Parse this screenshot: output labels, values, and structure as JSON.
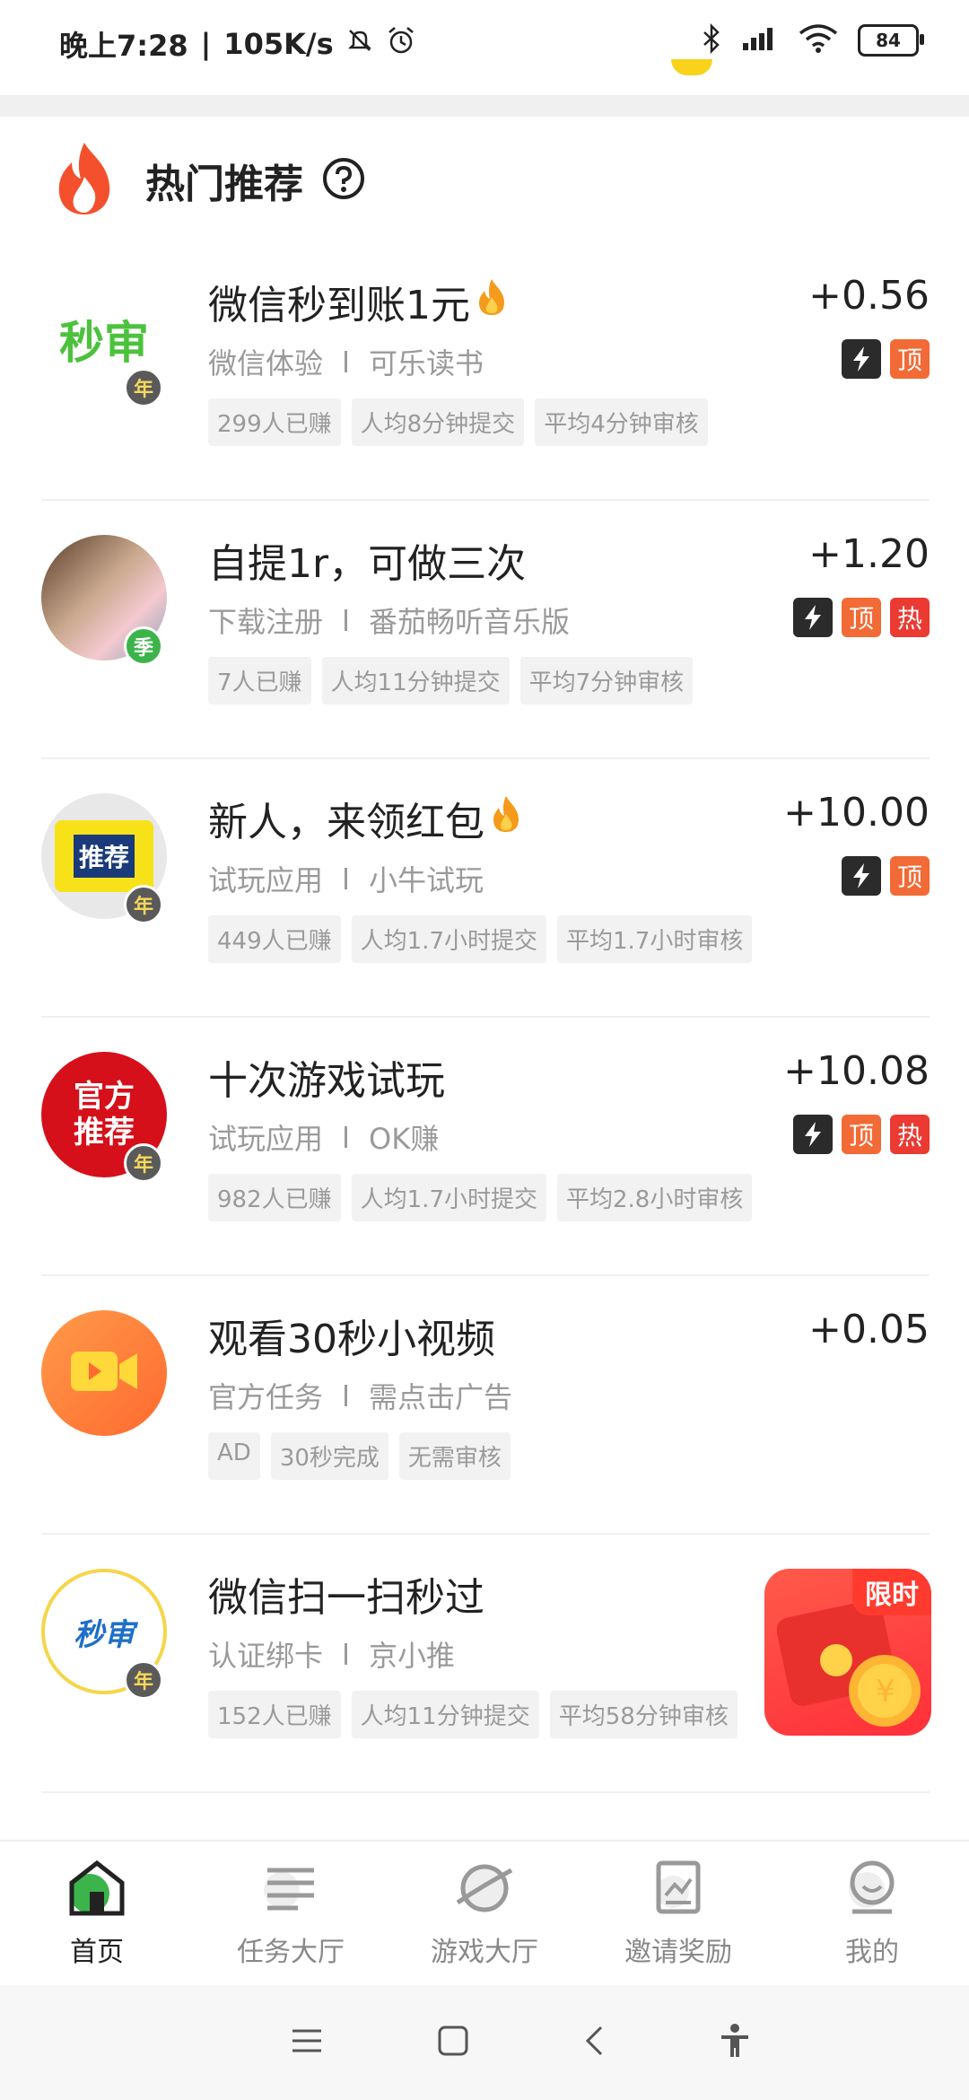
{
  "status_bar": {
    "time": "晚上7:28",
    "speed": "105K/s",
    "battery": "84"
  },
  "section": {
    "title": "热门推荐"
  },
  "tasks": [
    {
      "title": "微信秒到账1元",
      "reward": "+0.56",
      "category": "微信体验",
      "app": "可乐读书",
      "tags": [
        "299人已赚",
        "人均8分钟提交",
        "平均4分钟审核"
      ],
      "badge": "年",
      "avatar_text": "秒审",
      "flags": [
        "bolt",
        "顶"
      ]
    },
    {
      "title": "自提1r，可做三次",
      "reward": "+1.20",
      "category": "下载注册",
      "app": "番茄畅听音乐版",
      "tags": [
        "7人已赚",
        "人均11分钟提交",
        "平均7分钟审核"
      ],
      "badge": "季",
      "avatar_text": "",
      "flags": [
        "bolt",
        "顶",
        "热"
      ]
    },
    {
      "title": "新人，来领红包",
      "reward": "+10.00",
      "category": "试玩应用",
      "app": "小牛试玩",
      "tags": [
        "449人已赚",
        "人均1.7小时提交",
        "平均1.7小时审核"
      ],
      "badge": "年",
      "avatar_text": "推荐",
      "flags": [
        "bolt",
        "顶"
      ]
    },
    {
      "title": "十次游戏试玩",
      "reward": "+10.08",
      "category": "试玩应用",
      "app": "OK赚",
      "tags": [
        "982人已赚",
        "人均1.7小时提交",
        "平均2.8小时审核"
      ],
      "badge": "年",
      "avatar_text": "官方推荐",
      "flags": [
        "bolt",
        "顶",
        "热"
      ]
    },
    {
      "title": "观看30秒小视频",
      "reward": "+0.05",
      "category": "官方任务",
      "app": "需点击广告",
      "tags": [
        "AD",
        "30秒完成",
        "无需审核"
      ],
      "badge": "",
      "avatar_text": "",
      "flags": []
    },
    {
      "title": "微信扫一扫秒过",
      "reward": "",
      "category": "认证绑卡",
      "app": "京小推",
      "tags": [
        "152人已赚",
        "人均11分钟提交",
        "平均58分钟审核"
      ],
      "badge": "年",
      "avatar_text": "秒审",
      "flags": [
        "bolt"
      ]
    }
  ],
  "promo": {
    "label": "限时"
  },
  "bottom_nav": [
    {
      "label": "首页",
      "icon": "home-icon",
      "active": true
    },
    {
      "label": "任务大厅",
      "icon": "list-icon",
      "active": false
    },
    {
      "label": "游戏大厅",
      "icon": "planet-icon",
      "active": false
    },
    {
      "label": "邀请奖励",
      "icon": "chart-icon",
      "active": false
    },
    {
      "label": "我的",
      "icon": "profile-icon",
      "active": false
    }
  ],
  "colors": {
    "accent_orange": "#f26a35",
    "hot_red": "#ea3a32",
    "bolt_dark": "#2b2b2b",
    "home_green": "#3cb44b"
  }
}
